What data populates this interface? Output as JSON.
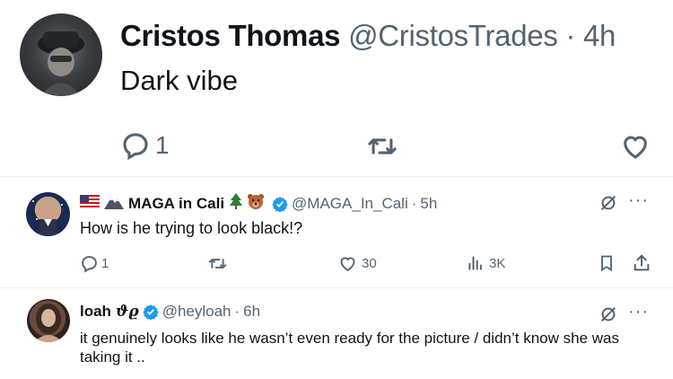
{
  "post1": {
    "name": "Cristos Thomas",
    "handle": "@CristosTrades",
    "sep": "·",
    "time": "4h",
    "text": "Dark vibe",
    "reply_count": "1",
    "icons": {
      "reply": "reply-icon",
      "retweet": "retweet-icon",
      "like": "heart-icon"
    }
  },
  "post2": {
    "name": "MAGA in Cali",
    "handle": "@MAGA_In_Cali",
    "sep": "·",
    "time": "5h",
    "text": "How is he trying to look black!?",
    "reply_count": "1",
    "like_count": "30",
    "view_count": "3K",
    "colors": {
      "verified": "#1d9bf0"
    }
  },
  "post3": {
    "name": "loah",
    "name_suffix": "ϑϱ",
    "handle": "@heyloah",
    "sep": "·",
    "time": "6h",
    "text": "it genuinely looks like he wasn’t even ready for the picture / didn’t know she was taking it .."
  },
  "more_label": "···"
}
